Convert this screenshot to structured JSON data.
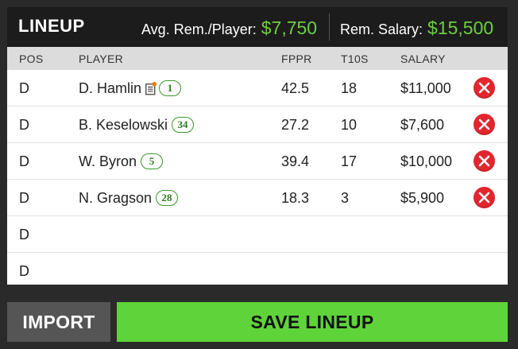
{
  "header": {
    "title": "LINEUP",
    "avg_label": "Avg. Rem./Player:",
    "avg_value": "$7,750",
    "rem_label": "Rem. Salary:",
    "rem_value": "$15,500"
  },
  "columns": {
    "pos": "POS",
    "player": "PLAYER",
    "fppr": "FPPR",
    "t10s": "T10S",
    "salary": "SALARY"
  },
  "rows": [
    {
      "pos": "D",
      "player": "D. Hamlin",
      "number": "1",
      "news_icon": "news-doc-icon",
      "fppr": "42.5",
      "t10s": "18",
      "salary": "$11,000"
    },
    {
      "pos": "D",
      "player": "B. Keselowski",
      "number": "34",
      "fppr": "27.2",
      "t10s": "10",
      "salary": "$7,600"
    },
    {
      "pos": "D",
      "player": "W. Byron",
      "number": "5",
      "fppr": "39.4",
      "t10s": "17",
      "salary": "$10,000"
    },
    {
      "pos": "D",
      "player": "N. Gragson",
      "number": "28",
      "fppr": "18.3",
      "t10s": "3",
      "salary": "$5,900"
    },
    {
      "pos": "D"
    },
    {
      "pos": "D"
    }
  ],
  "buttons": {
    "import": "IMPORT",
    "save": "SAVE LINEUP"
  },
  "colors": {
    "accent_green": "#6ccf3f",
    "save_button": "#5fd33a",
    "remove_red": "#e3252d",
    "badge_green": "#3b9a2a"
  }
}
